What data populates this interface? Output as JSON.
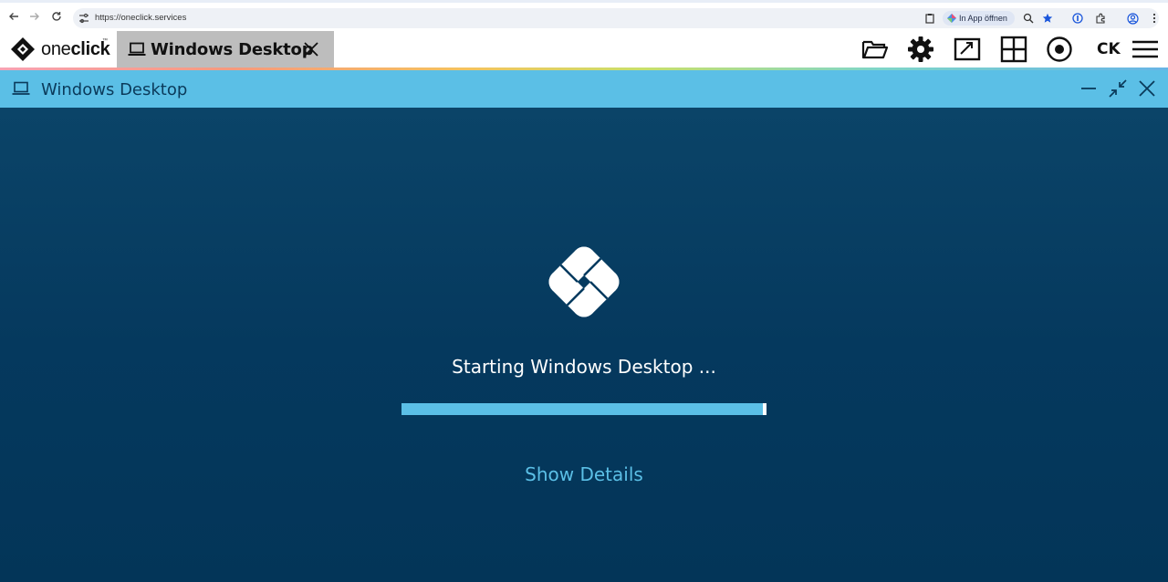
{
  "browser": {
    "url": "https://oneclick.services",
    "open_in_app_label": "In App öffnen"
  },
  "app": {
    "logo_text_light": "one",
    "logo_text_bold": "click",
    "logo_tm": "™",
    "tab_label": "Windows Desktop",
    "user_initials": "CK"
  },
  "window": {
    "title": "Windows Desktop"
  },
  "main": {
    "status_text": "Starting Windows Desktop ...",
    "progress_percent": 99,
    "details_label": "Show Details"
  },
  "colors": {
    "accent": "#5bbfe6",
    "background": "#05395e"
  }
}
